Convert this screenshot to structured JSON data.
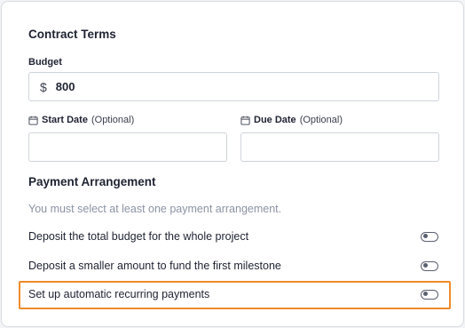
{
  "contract_terms": {
    "title": "Contract Terms",
    "budget": {
      "label": "Budget",
      "currency_symbol": "$",
      "value": "800"
    },
    "start_date": {
      "label": "Start Date",
      "optional_text": "(Optional)",
      "value": ""
    },
    "due_date": {
      "label": "Due Date",
      "optional_text": "(Optional)",
      "value": ""
    }
  },
  "payment_arrangement": {
    "title": "Payment Arrangement",
    "helper_text": "You must select at least one payment arrangement.",
    "options": [
      {
        "label": "Deposit the total budget for the whole project",
        "enabled": false
      },
      {
        "label": "Deposit a smaller amount to fund the first milestone",
        "enabled": false
      },
      {
        "label": "Set up automatic recurring payments",
        "enabled": false,
        "highlighted": true
      }
    ]
  },
  "colors": {
    "highlight": "#f08a2c",
    "helper_text": "#8b93a3",
    "border": "#cfd4da"
  },
  "icons": {
    "date": "calendar-icon",
    "currency": "dollar-icon",
    "toggle": "toggle-off"
  }
}
